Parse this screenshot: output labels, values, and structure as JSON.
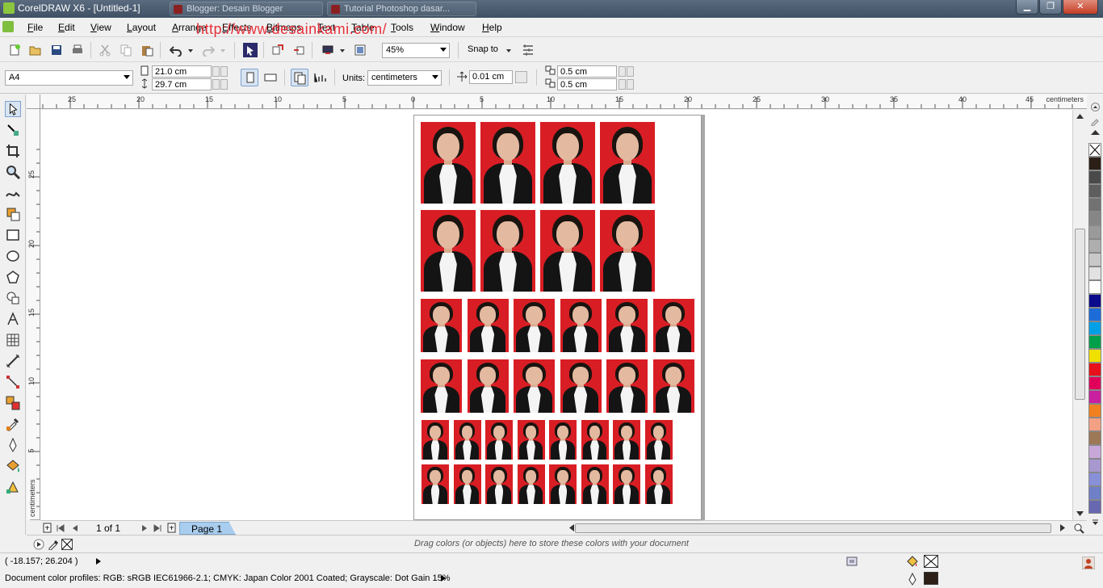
{
  "titlebar": {
    "title": "CorelDRAW X6 - [Untitled-1]",
    "tasks": [
      "Blogger: Desain Blogger",
      "Tutorial Photoshop dasar..."
    ],
    "min_label": "▁",
    "max_label": "❐",
    "close_label": "✕"
  },
  "menu": {
    "items": [
      "File",
      "Edit",
      "View",
      "Layout",
      "Arrange",
      "Effects",
      "Bitmaps",
      "Text",
      "Table",
      "Tools",
      "Window",
      "Help"
    ],
    "mdi_min": "–",
    "mdi_restore": "▫",
    "mdi_close": "✕"
  },
  "watermark": "http://www.desainkami.com/",
  "toolbar": {
    "zoom": "45%",
    "snap_label": "Snap to"
  },
  "propertybar": {
    "page_size": "A4",
    "width": "21.0 cm",
    "height": "29.7 cm",
    "units_label": "Units:",
    "units_value": "centimeters",
    "nudge": "0.01 cm",
    "dup_x": "0.5 cm",
    "dup_y": "0.5 cm"
  },
  "rulers": {
    "units": "centimeters",
    "h_ticks": [
      "25",
      "20",
      "15",
      "10",
      "5",
      "0",
      "5",
      "10",
      "15",
      "20",
      "25",
      "30",
      "35",
      "40",
      "45"
    ],
    "v_ticks": [
      "25",
      "20",
      "15",
      "10",
      "5"
    ]
  },
  "pagenav": {
    "counter": "1 of 1",
    "tab": "Page 1"
  },
  "docpalette": {
    "hint": "Drag colors (or objects) here to store these colors with your document"
  },
  "status": {
    "coords": "( -18.157; 26.204 )",
    "profiles": "Document color profiles: RGB: sRGB IEC61966-2.1; CMYK: Japan Color 2001 Coated; Grayscale: Dot Gain 15%"
  },
  "palette": {
    "colors": [
      "#2b1f18",
      "#4a4a4a",
      "#5e5e5e",
      "#727272",
      "#868686",
      "#9a9a9a",
      "#aeaeae",
      "#c8c8c8",
      "#e2e2e2",
      "#ffffff",
      "#0b0b8c",
      "#1e6cd8",
      "#00a0e6",
      "#00a04a",
      "#f0e000",
      "#e8101a",
      "#e0005a",
      "#c8209e",
      "#f08020",
      "#f4a084",
      "#9c7856",
      "#c8a8d8",
      "#a898d0",
      "#8890d8",
      "#7080c8",
      "#6868b0"
    ]
  }
}
